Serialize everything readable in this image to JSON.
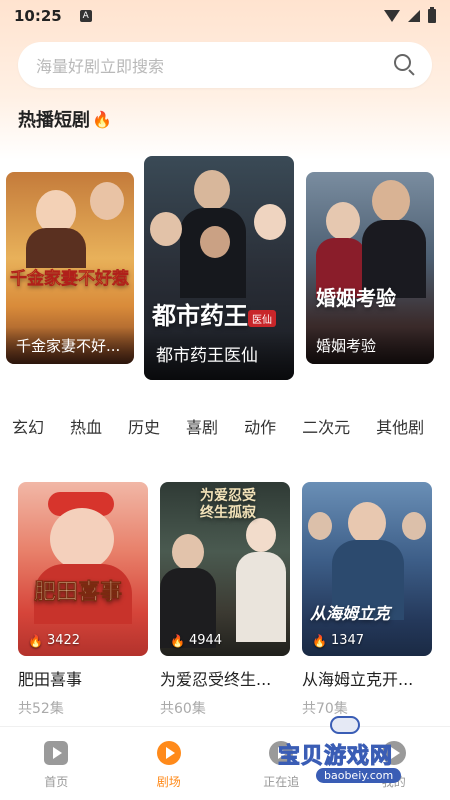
{
  "status_bar": {
    "time": "10:25",
    "notification_glyph": "A"
  },
  "search": {
    "placeholder": "海量好剧立即搜索"
  },
  "hot_section": {
    "title": "热播短剧",
    "cards": [
      {
        "caption": "千金家妻不好...",
        "art_text": "千金家妻不好惹"
      },
      {
        "caption": "都市药王医仙",
        "art_text": "都市药王"
      },
      {
        "caption": "婚姻考验",
        "art_text": "婚姻考验"
      }
    ]
  },
  "categories": [
    "玄幻",
    "热血",
    "历史",
    "喜剧",
    "动作",
    "二次元",
    "其他剧"
  ],
  "dramas": [
    {
      "title": "肥田喜事",
      "views": "3422",
      "episodes": "共52集",
      "art_text": "肥田喜事"
    },
    {
      "title": "为爱忍受终生...",
      "views": "4944",
      "episodes": "共60集",
      "art_text": "为爱忍受终生孤寂"
    },
    {
      "title": "从海姆立克开...",
      "views": "1347",
      "episodes": "共70集",
      "art_text": "从海姆立克"
    }
  ],
  "bottom_nav": [
    {
      "label": "首页",
      "active": false
    },
    {
      "label": "剧场",
      "active": true
    },
    {
      "label": "正在追",
      "active": false
    },
    {
      "label": "我的",
      "active": false
    }
  ],
  "watermark": {
    "text": "宝贝游戏网",
    "url": "baobeiy.com"
  },
  "colors": {
    "accent": "#ff8a1a",
    "header_bg": "#ffe3cf"
  }
}
